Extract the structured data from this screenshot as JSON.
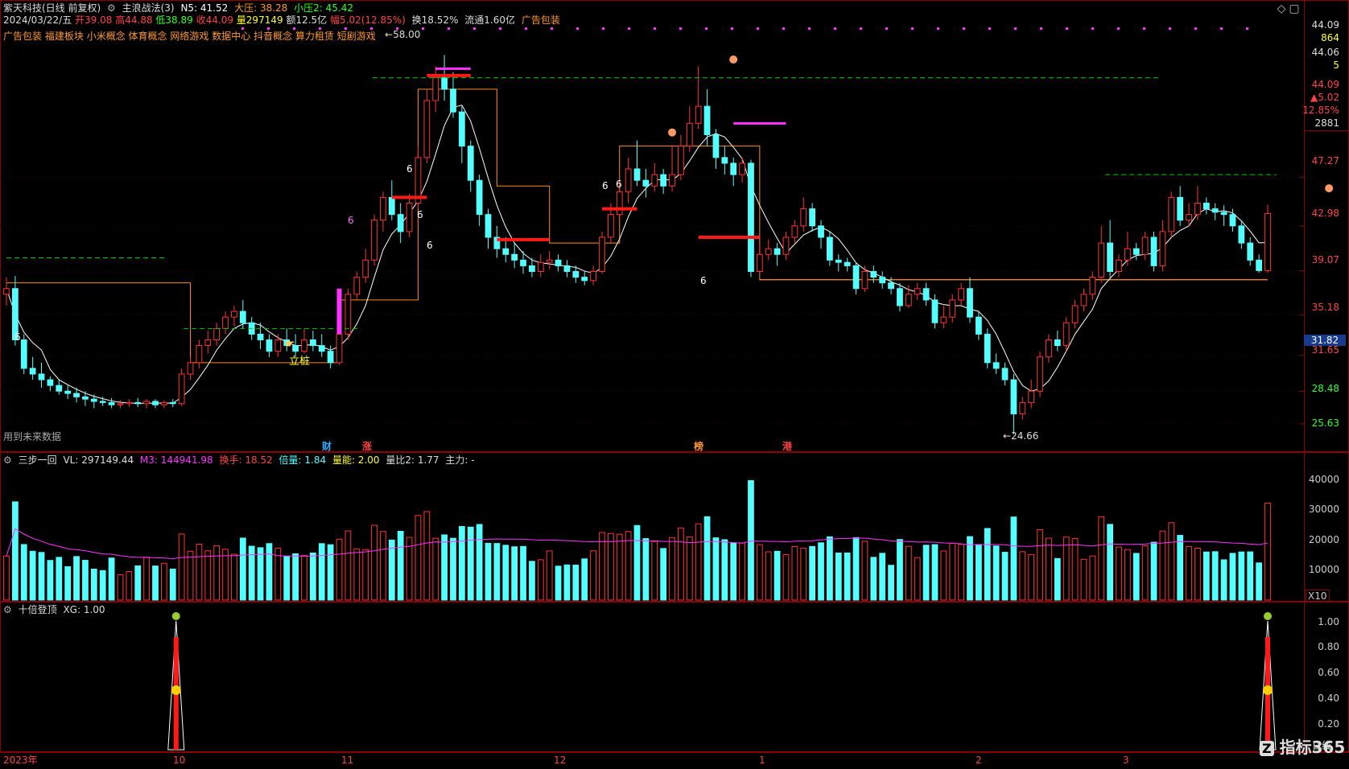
{
  "header": {
    "stock": "紫天科技(日线 前复权)",
    "indicator": "主浪战法(3)",
    "n5_label": "N5: 41.52",
    "dy_label": "大压: 38.28",
    "xy_label": "小压2: 45.42",
    "date": "2024/03/22/五",
    "open": "开39.08",
    "high": "高44.88",
    "low": "低38.89",
    "close": "收44.09",
    "volume": "量297149",
    "amount": "额12.5亿",
    "change": "幅5.02(12.85%)",
    "turnover": "换18.52%",
    "float": "流通1.60亿",
    "concept_top": "广告包装",
    "concepts": [
      "广告包装",
      "福建板块",
      "小米概念",
      "体育概念",
      "网络游戏",
      "数据中心",
      "抖音概念",
      "算力租赁",
      "短剧游戏"
    ]
  },
  "right_panel": {
    "price_top": "44.09",
    "vol_top": "864",
    "price2": "44.06",
    "vol2": "5",
    "price3": "44.09",
    "chg": "▲5.02",
    "pct": "12.85%",
    "count": "2881",
    "cursor_price": "31.82",
    "axis_prices": [
      "47.27",
      "42.98",
      "39.07",
      "35.18",
      "31.65",
      "28.48",
      "25.63"
    ],
    "axis_vol": [
      "40000",
      "30000",
      "20000",
      "10000"
    ],
    "vol_unit": "X10",
    "axis_sig": [
      "1.00",
      "0.80",
      "0.60",
      "0.40",
      "0.20"
    ],
    "period": "日线"
  },
  "main_chart": {
    "note": "用到未来数据",
    "peak_label": "58.00",
    "low_label": "24.66",
    "li_zhuang": "立桩",
    "markers": [
      "财",
      "涨",
      "榜",
      "港"
    ],
    "six": "6"
  },
  "volume_panel": {
    "title": "三步一回",
    "vl": "VL: 297149.44",
    "m3": "M3: 144941.98",
    "turn": "换手: 18.52",
    "bei": "倍量: 1.84",
    "liang": "量能: 2.00",
    "liangbi": "量比2: 1.77",
    "zhuli": "主力: -"
  },
  "signal_panel": {
    "title": "十倍登顶",
    "xg": "XG: 1.00"
  },
  "xaxis": [
    "2023年",
    "10",
    "11",
    "12",
    "1",
    "2",
    "3"
  ],
  "brand": "指标365",
  "colors": {
    "up": "#ff3333",
    "down": "#54ffff",
    "ma": "#ffffff",
    "step": "#ff8c1a",
    "dash": "#00cc00",
    "magenta": "#ff33ff"
  },
  "chart_data": {
    "type": "candlestick",
    "title": "",
    "x_start": "2023-09",
    "x_end": "2024-03-22",
    "ylim": [
      24,
      60
    ],
    "candles": [
      [
        37.0,
        37.5,
        38.5,
        36.0
      ],
      [
        37.5,
        33.0,
        38.6,
        32.5
      ],
      [
        33.0,
        30.5,
        33.5,
        30.0
      ],
      [
        30.5,
        30.0,
        31.5,
        29.5
      ],
      [
        30.0,
        29.5,
        31.0,
        28.8
      ],
      [
        29.5,
        29.0,
        29.8,
        28.5
      ],
      [
        29.0,
        28.5,
        29.5,
        28.2
      ],
      [
        28.5,
        28.3,
        29.0,
        27.8
      ],
      [
        28.3,
        28.0,
        28.8,
        27.5
      ],
      [
        28.0,
        27.8,
        28.5,
        27.2
      ],
      [
        27.8,
        27.6,
        28.2,
        27.0
      ],
      [
        27.6,
        27.5,
        28.0,
        27.2
      ],
      [
        27.5,
        27.3,
        27.9,
        27.0
      ],
      [
        27.3,
        27.4,
        27.7,
        27.0
      ],
      [
        27.4,
        27.5,
        27.8,
        27.1
      ],
      [
        27.5,
        27.4,
        27.9,
        27.1
      ],
      [
        27.4,
        27.6,
        27.8,
        27.0
      ],
      [
        27.6,
        27.3,
        27.8,
        27.0
      ],
      [
        27.3,
        27.5,
        27.7,
        27.0
      ],
      [
        27.5,
        27.4,
        27.8,
        27.1
      ],
      [
        27.4,
        30.0,
        30.5,
        27.2
      ],
      [
        30.0,
        31.0,
        31.5,
        29.5
      ],
      [
        31.0,
        32.5,
        33.0,
        30.5
      ],
      [
        32.5,
        33.0,
        33.8,
        31.8
      ],
      [
        33.0,
        34.0,
        34.5,
        32.5
      ],
      [
        34.0,
        35.0,
        35.5,
        33.5
      ],
      [
        35.0,
        35.5,
        36.0,
        34.2
      ],
      [
        35.5,
        34.5,
        36.5,
        34.0
      ],
      [
        34.5,
        33.5,
        35.0,
        33.0
      ],
      [
        33.5,
        33.0,
        34.5,
        32.2
      ],
      [
        33.0,
        32.0,
        33.5,
        31.5
      ],
      [
        32.0,
        33.0,
        33.5,
        31.5
      ],
      [
        33.0,
        32.5,
        34.0,
        32.0
      ],
      [
        32.5,
        32.0,
        33.5,
        31.5
      ],
      [
        32.0,
        33.0,
        34.0,
        31.8
      ],
      [
        33.0,
        32.5,
        33.8,
        32.0
      ],
      [
        32.5,
        32.0,
        33.5,
        31.5
      ],
      [
        32.0,
        31.0,
        32.5,
        30.5
      ],
      [
        31.0,
        33.5,
        34.0,
        30.8
      ],
      [
        33.5,
        37.0,
        37.5,
        33.0
      ],
      [
        37.0,
        38.5,
        39.0,
        36.5
      ],
      [
        38.5,
        40.0,
        41.0,
        38.0
      ],
      [
        40.0,
        43.5,
        44.0,
        39.5
      ],
      [
        43.5,
        45.5,
        46.0,
        42.5
      ],
      [
        45.5,
        44.0,
        47.0,
        43.5
      ],
      [
        44.0,
        42.5,
        45.0,
        41.5
      ],
      [
        42.5,
        45.0,
        45.8,
        42.0
      ],
      [
        45.0,
        49.0,
        50.0,
        44.5
      ],
      [
        49.0,
        54.0,
        55.0,
        48.5
      ],
      [
        54.0,
        56.0,
        57.0,
        53.0
      ],
      [
        56.0,
        55.0,
        58.0,
        54.0
      ],
      [
        55.0,
        53.0,
        56.5,
        52.5
      ],
      [
        53.0,
        50.0,
        53.5,
        48.5
      ],
      [
        50.0,
        47.0,
        50.5,
        46.0
      ],
      [
        47.0,
        44.0,
        47.5,
        43.0
      ],
      [
        44.0,
        42.0,
        44.5,
        41.0
      ],
      [
        42.0,
        41.0,
        43.0,
        40.2
      ],
      [
        41.0,
        40.5,
        42.0,
        39.8
      ],
      [
        40.5,
        40.0,
        41.5,
        39.3
      ],
      [
        40.0,
        39.5,
        40.8,
        38.8
      ],
      [
        39.5,
        39.0,
        40.2,
        38.5
      ],
      [
        39.0,
        39.8,
        40.5,
        38.5
      ],
      [
        39.8,
        40.0,
        40.8,
        39.2
      ],
      [
        40.0,
        39.5,
        40.5,
        39.0
      ],
      [
        39.5,
        39.0,
        40.0,
        38.5
      ],
      [
        39.0,
        38.5,
        39.5,
        38.0
      ],
      [
        38.5,
        38.2,
        39.0,
        37.8
      ],
      [
        38.2,
        39.0,
        39.5,
        37.8
      ],
      [
        39.0,
        42.0,
        42.5,
        38.8
      ],
      [
        42.0,
        44.0,
        45.0,
        41.5
      ],
      [
        44.0,
        46.0,
        47.0,
        43.5
      ],
      [
        46.0,
        48.0,
        49.0,
        45.0
      ],
      [
        48.0,
        47.0,
        50.5,
        46.5
      ],
      [
        47.0,
        46.5,
        48.0,
        45.5
      ],
      [
        46.5,
        47.5,
        48.5,
        46.0
      ],
      [
        47.5,
        46.5,
        48.0,
        45.8
      ],
      [
        46.5,
        47.5,
        50.0,
        46.0
      ],
      [
        47.5,
        50.0,
        51.0,
        47.0
      ],
      [
        50.0,
        52.0,
        53.5,
        49.5
      ],
      [
        52.0,
        53.5,
        57.0,
        51.5
      ],
      [
        53.5,
        51.0,
        55.0,
        50.0
      ],
      [
        51.0,
        49.0,
        51.5,
        48.0
      ],
      [
        49.0,
        48.5,
        50.0,
        47.5
      ],
      [
        48.5,
        47.5,
        49.0,
        46.5
      ],
      [
        47.5,
        48.5,
        49.0,
        46.8
      ],
      [
        48.5,
        39.0,
        48.8,
        38.5
      ],
      [
        39.0,
        40.5,
        41.5,
        38.8
      ],
      [
        40.5,
        41.0,
        41.8,
        40.0
      ],
      [
        41.0,
        40.5,
        41.5,
        39.5
      ],
      [
        40.5,
        42.0,
        42.5,
        40.0
      ],
      [
        42.0,
        43.0,
        43.5,
        41.5
      ],
      [
        43.0,
        44.5,
        45.5,
        42.5
      ],
      [
        44.5,
        43.0,
        45.0,
        42.5
      ],
      [
        43.0,
        42.0,
        43.5,
        41.0
      ],
      [
        42.0,
        40.0,
        42.5,
        39.5
      ],
      [
        40.0,
        39.8,
        40.5,
        39.0
      ],
      [
        39.8,
        39.5,
        40.2,
        39.0
      ],
      [
        39.5,
        37.5,
        39.8,
        37.0
      ],
      [
        37.5,
        39.0,
        39.5,
        37.2
      ],
      [
        39.0,
        38.5,
        39.5,
        38.0
      ],
      [
        38.5,
        38.0,
        39.0,
        37.5
      ],
      [
        38.0,
        37.5,
        38.5,
        37.0
      ],
      [
        37.5,
        36.0,
        38.0,
        35.5
      ],
      [
        36.0,
        37.0,
        37.8,
        35.8
      ],
      [
        37.0,
        37.5,
        38.0,
        36.5
      ],
      [
        37.5,
        36.5,
        38.0,
        36.0
      ],
      [
        36.5,
        34.5,
        37.0,
        34.0
      ],
      [
        34.5,
        35.0,
        36.0,
        34.0
      ],
      [
        35.0,
        36.5,
        37.0,
        34.5
      ],
      [
        36.5,
        37.5,
        38.0,
        36.0
      ],
      [
        37.5,
        35.0,
        38.5,
        34.5
      ],
      [
        35.0,
        33.5,
        35.5,
        33.0
      ],
      [
        33.5,
        31.0,
        34.0,
        30.5
      ],
      [
        31.0,
        30.5,
        31.8,
        30.0
      ],
      [
        30.5,
        29.5,
        31.0,
        29.0
      ],
      [
        29.5,
        26.5,
        30.0,
        24.7
      ],
      [
        26.5,
        27.5,
        28.0,
        26.0
      ],
      [
        27.5,
        28.5,
        29.5,
        27.0
      ],
      [
        28.5,
        31.5,
        32.0,
        28.0
      ],
      [
        31.5,
        33.0,
        33.5,
        31.0
      ],
      [
        33.0,
        32.5,
        33.8,
        32.0
      ],
      [
        32.5,
        34.5,
        35.0,
        32.0
      ],
      [
        34.5,
        36.0,
        36.5,
        34.0
      ],
      [
        36.0,
        37.0,
        37.5,
        35.5
      ],
      [
        37.0,
        38.5,
        39.0,
        36.5
      ],
      [
        38.5,
        41.5,
        43.0,
        38.0
      ],
      [
        41.5,
        39.0,
        43.5,
        38.5
      ],
      [
        39.0,
        40.0,
        40.5,
        38.5
      ],
      [
        40.0,
        41.0,
        42.5,
        39.5
      ],
      [
        41.0,
        40.5,
        41.5,
        40.0
      ],
      [
        40.5,
        42.0,
        42.5,
        40.0
      ],
      [
        42.0,
        39.5,
        42.5,
        39.0
      ],
      [
        39.5,
        42.5,
        43.5,
        39.0
      ],
      [
        42.5,
        45.5,
        46.0,
        42.0
      ],
      [
        45.5,
        43.5,
        46.5,
        43.0
      ],
      [
        43.5,
        44.0,
        45.0,
        43.0
      ],
      [
        44.0,
        45.0,
        46.5,
        43.5
      ],
      [
        45.0,
        44.5,
        45.5,
        44.0
      ],
      [
        44.5,
        44.2,
        45.0,
        43.5
      ],
      [
        44.2,
        44.0,
        44.8,
        43.0
      ],
      [
        44.0,
        43.0,
        44.5,
        42.5
      ],
      [
        43.0,
        41.5,
        43.5,
        41.0
      ],
      [
        41.5,
        40.0,
        42.0,
        39.5
      ],
      [
        40.0,
        39.08,
        40.5,
        38.89
      ],
      [
        39.08,
        44.09,
        44.88,
        38.89
      ]
    ]
  }
}
